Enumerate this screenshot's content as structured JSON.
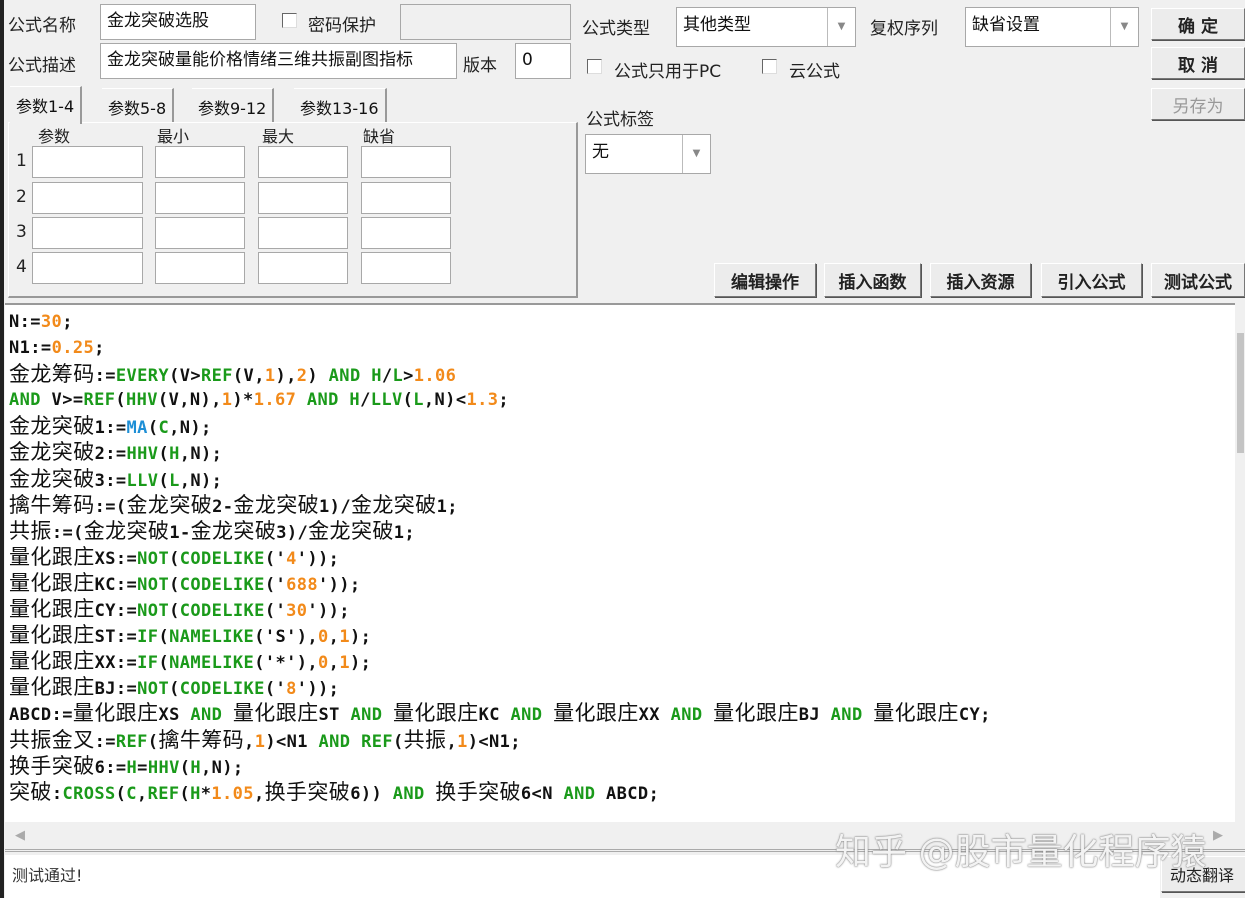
{
  "form": {
    "name_label": "公式名称",
    "name_value": "金龙突破选股",
    "password_label": "密码保护",
    "password_value": "",
    "desc_label": "公式描述",
    "desc_value": "金龙突破量能价格情绪三维共振副图指标",
    "version_label": "版本",
    "version_value": "0",
    "type_label": "公式类型",
    "type_value": "其他类型",
    "rights_label": "复权序列",
    "rights_value": "缺省设置",
    "pc_only_label": "公式只用于PC",
    "cloud_label": "云公式",
    "tag_label": "公式标签",
    "tag_value": "无"
  },
  "buttons": {
    "ok": "确 定",
    "cancel": "取 消",
    "save_as": "另存为",
    "edit": "编辑操作",
    "insert_func": "插入函数",
    "insert_res": "插入资源",
    "import": "引入公式",
    "test": "测试公式",
    "translate": "动态翻译"
  },
  "params": {
    "tabs": [
      "参数1-4",
      "参数5-8",
      "参数9-12",
      "参数13-16"
    ],
    "headers": [
      "参数",
      "最小",
      "最大",
      "缺省"
    ],
    "rows": [
      "1",
      "2",
      "3",
      "4"
    ]
  },
  "code_lines": [
    "N:=30;",
    "N1:=0.25;",
    "金龙筹码:=EVERY(V>REF(V,1),2) AND H/L>1.06",
    "AND V>=REF(HHV(V,N),1)*1.67 AND H/LLV(L,N)<1.3;",
    "金龙突破1:=MA(C,N);",
    "金龙突破2:=HHV(H,N);",
    "金龙突破3:=LLV(L,N);",
    "擒牛筹码:=(金龙突破2-金龙突破1)/金龙突破1;",
    "共振:=(金龙突破1-金龙突破3)/金龙突破1;",
    "量化跟庄XS:=NOT(CODELIKE('4'));",
    "量化跟庄KC:=NOT(CODELIKE('688'));",
    "量化跟庄CY:=NOT(CODELIKE('30'));",
    "量化跟庄ST:=IF(NAMELIKE('S'),0,1);",
    "量化跟庄XX:=IF(NAMELIKE('*'),0,1);",
    "量化跟庄BJ:=NOT(CODELIKE('8'));",
    "ABCD:=量化跟庄XS AND 量化跟庄ST AND 量化跟庄KC AND 量化跟庄XX AND 量化跟庄BJ AND 量化跟庄CY;",
    "共振金叉:=REF(擒牛筹码,1)<N1 AND REF(共振,1)<N1;",
    "换手突破6:=H=HHV(H,N);",
    "突破:CROSS(C,REF(H*1.05,换手突破6)) AND 换手突破6<N AND ABCD;"
  ],
  "status": "测试通过!",
  "watermark": "知乎 @股市量化程序猿",
  "colors": {
    "function": "#1a9a1a",
    "number": "#f28a1a",
    "ma": "#1e8fd6"
  }
}
